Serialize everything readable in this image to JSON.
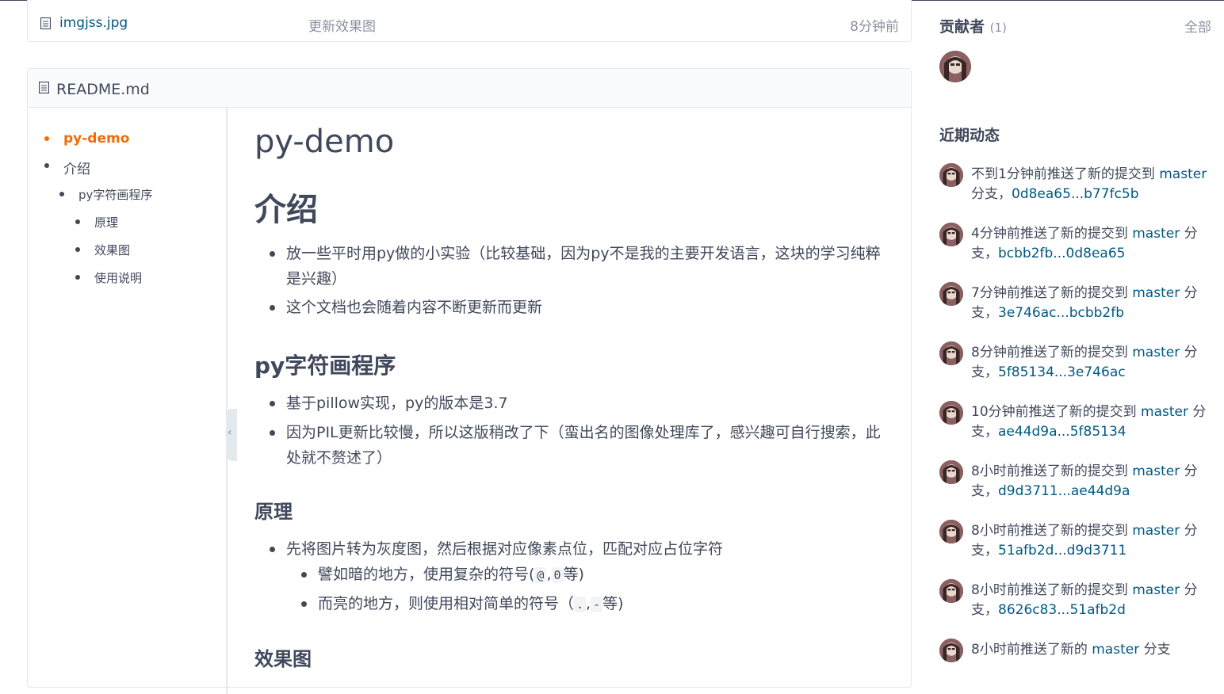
{
  "file_row": {
    "name": "imgjss.jpg",
    "message": "更新效果图",
    "time": "8分钟前"
  },
  "readme": {
    "title": "README.md",
    "toc": [
      {
        "label": "py-demo"
      },
      {
        "label": "介绍"
      },
      {
        "label": "py字符画程序"
      },
      {
        "label": "原理"
      },
      {
        "label": "效果图"
      },
      {
        "label": "使用说明"
      }
    ],
    "h1": "py-demo",
    "intro_heading": "介绍",
    "intro_items": [
      "放一些平时用py做的小实验（比较基础，因为py不是我的主要开发语言，这块的学习纯粹是兴趣）",
      "这个文档也会随着内容不断更新而更新"
    ],
    "art_heading": "py字符画程序",
    "art_items": [
      "基于pillow实现，py的版本是3.7",
      "因为PIL更新比较慢，所以这版稍改了下（蛮出名的图像处理库了，感兴趣可自行搜索，此处就不赘述了）"
    ],
    "principle_heading": "原理",
    "principle_item": "先将图片转为灰度图，然后根据对应像素点位，匹配对应占位字符",
    "dark_prefix": "譬如暗的地方，使用复杂的符号(",
    "dark_code1": "@",
    "dark_sep": ",",
    "dark_code2": "0",
    "dark_suffix": "等)",
    "light_prefix": "而亮的地方，则使用相对简单的符号（",
    "light_code1": ".",
    "light_sep": ",",
    "light_code2": "-",
    "light_suffix": "等)",
    "effect_heading": "效果图"
  },
  "sidebar": {
    "contributors_title": "贡献者",
    "contributors_count": "(1)",
    "all_label": "全部",
    "activity_title": "近期动态",
    "activities": [
      {
        "text": "不到1分钟前推送了新的提交到 ",
        "branch": "master",
        "after": "分支，",
        "commits": "0d8ea65...b77fc5b"
      },
      {
        "text": "4分钟前推送了新的提交到 ",
        "branch": "master",
        "after": " 分支，",
        "commits": "bcbb2fb...0d8ea65"
      },
      {
        "text": "7分钟前推送了新的提交到 ",
        "branch": "master",
        "after": " 分支，",
        "commits": "3e746ac...bcbb2fb"
      },
      {
        "text": "8分钟前推送了新的提交到 ",
        "branch": "master",
        "after": " 分支，",
        "commits": "5f85134...3e746ac"
      },
      {
        "text": "10分钟前推送了新的提交到 ",
        "branch": "master",
        "after": " 分支，",
        "commits": "ae44d9a...5f85134"
      },
      {
        "text": "8小时前推送了新的提交到 ",
        "branch": "master",
        "after": " 分支，",
        "commits": "d9d3711...ae44d9a"
      },
      {
        "text": "8小时前推送了新的提交到 ",
        "branch": "master",
        "after": " 分支，",
        "commits": "51afb2d...d9d3711"
      },
      {
        "text": "8小时前推送了新的提交到 ",
        "branch": "master",
        "after": " 分支，",
        "commits": "8626c83...51afb2d"
      },
      {
        "text": "8小时前推送了新的 ",
        "branch": "master",
        "after": " 分支",
        "commits": ""
      }
    ]
  },
  "colors": {
    "link": "#005980",
    "accent": "#f36b0b",
    "text": "#40485b",
    "muted": "#8c92a4",
    "border": "#e3e9ed"
  }
}
